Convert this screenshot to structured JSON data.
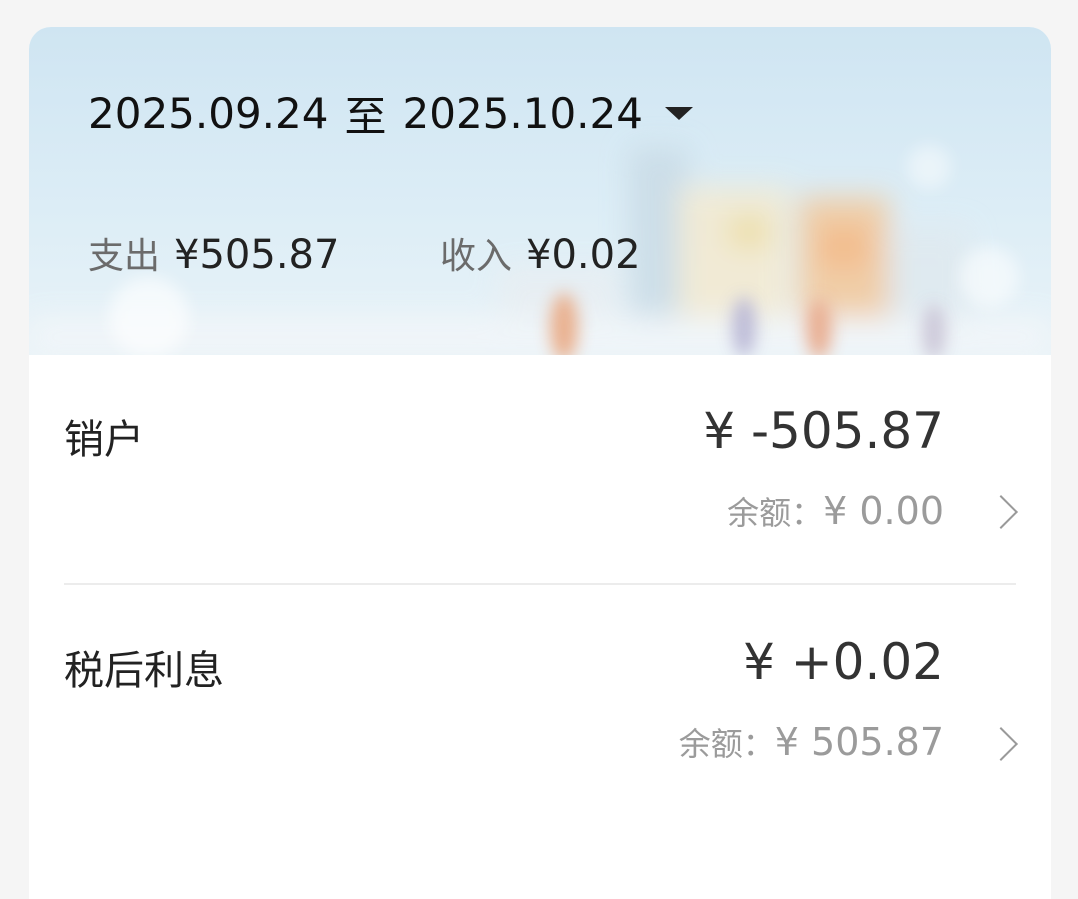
{
  "header": {
    "start_date": "2025.09.24",
    "separator": "至",
    "end_date": "2025.10.24",
    "expense_label": "支出",
    "expense_value": "¥505.87",
    "income_label": "收入",
    "income_value": "¥0.02"
  },
  "transactions": [
    {
      "title": "销户",
      "amount": "¥ -505.87",
      "balance_label": "余额：",
      "balance_value": "¥ 0.00"
    },
    {
      "title": "税后利息",
      "amount": "¥ +0.02",
      "balance_label": "余额：",
      "balance_value": "¥ 505.87"
    }
  ],
  "icons": {
    "range_dropdown": "caret-down-icon",
    "row_arrow": "chevron-right-icon"
  },
  "colors": {
    "header_bg": "#d6eaf5",
    "text_primary": "#222222",
    "text_secondary": "#9b9b9b"
  }
}
